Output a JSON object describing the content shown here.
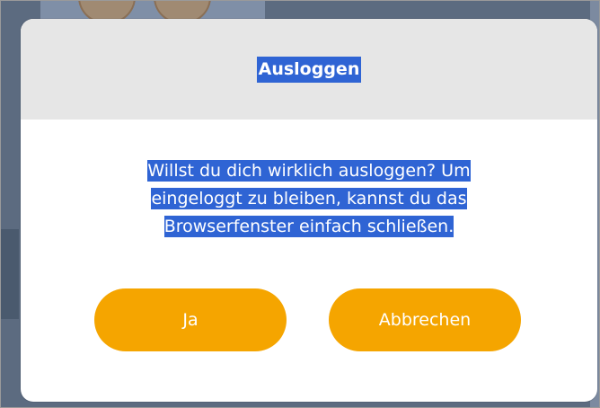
{
  "dialog": {
    "title": "Ausloggen",
    "message_lines": [
      "Willst du dich wirklich ausloggen? Um",
      "eingeloggt zu bleiben, kannst du das",
      "Browserfenster einfach schließen."
    ],
    "confirm_label": "Ja",
    "cancel_label": "Abbrechen"
  },
  "colors": {
    "accent": "#f5a500",
    "selection": "#2f64d4",
    "header_bg": "#e6e6e6"
  }
}
